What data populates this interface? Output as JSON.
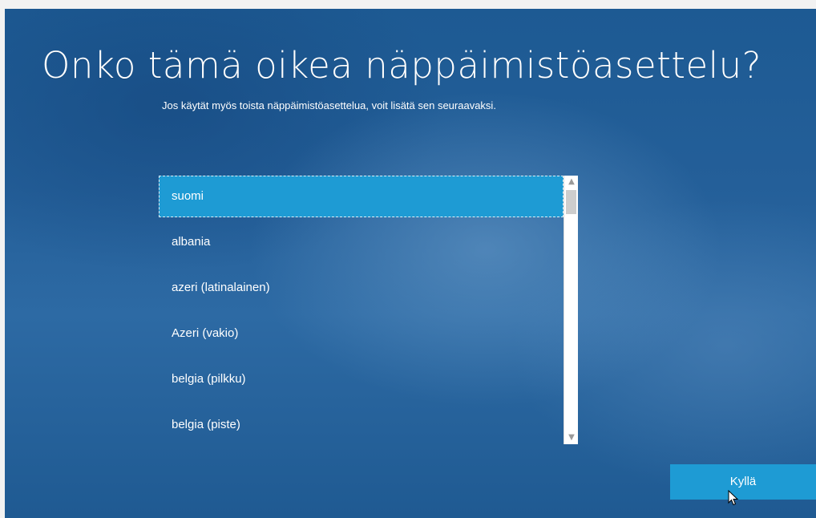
{
  "title": "Onko tämä oikea näppäimistöasettelu?",
  "subtitle": "Jos käytät myös toista näppäimistöasettelua, voit lisätä sen seuraavaksi.",
  "layouts": {
    "selected": "suomi",
    "items": [
      "suomi",
      "albania",
      "azeri (latinalainen)",
      "Azeri (vakio)",
      "belgia (pilkku)",
      "belgia (piste)"
    ]
  },
  "scrollbar": {
    "up_icon": "chevron-up",
    "down_icon": "chevron-down"
  },
  "yes_button": {
    "label": "Kyllä"
  },
  "colors": {
    "accent": "#1e9bd4",
    "background": "#245f99",
    "text": "#ffffff"
  }
}
